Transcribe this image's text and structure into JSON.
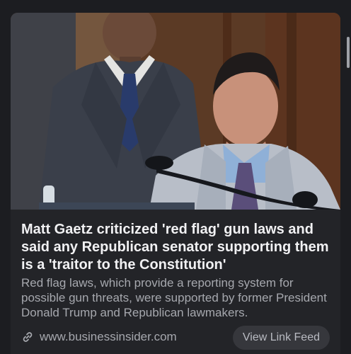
{
  "article": {
    "headline": "Matt Gaetz criticized 'red flag' gun laws and said any Republican senator supporting them is a 'traitor to the Constitution'",
    "summary": "Red flag laws, which provide a reporting system for possible gun threats, were supported by former President Donald Trump and Republican lawmakers.",
    "source": "www.businessinsider.com",
    "source_icon": "link-icon"
  },
  "actions": {
    "view_feed_label": "View Link Feed"
  },
  "colors": {
    "background": "#1c1d21",
    "card": "#232428",
    "headline_text": "#f1f1f3",
    "secondary_text": "#a6a8ae",
    "button": "#36373c"
  }
}
